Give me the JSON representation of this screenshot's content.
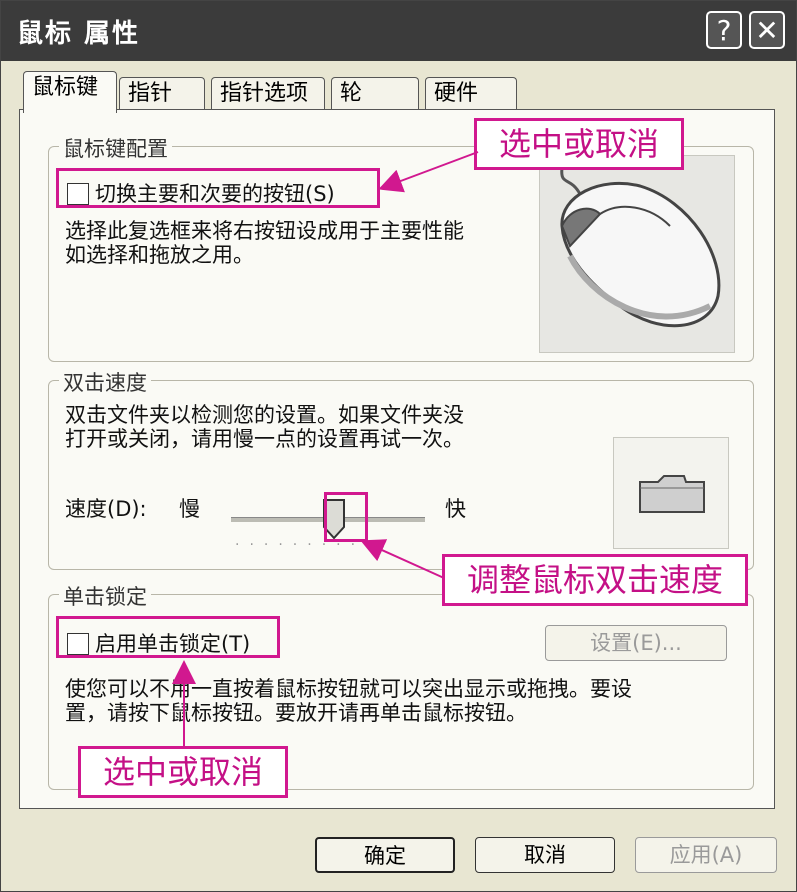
{
  "window": {
    "title": "鼠标  属性",
    "help_glyph": "?",
    "close_glyph": "✕"
  },
  "tabs": [
    {
      "label": "鼠标键",
      "active": true
    },
    {
      "label": "指针",
      "active": false
    },
    {
      "label": "指针选项",
      "active": false
    },
    {
      "label": "轮",
      "active": false
    },
    {
      "label": "硬件",
      "active": false
    }
  ],
  "button_config": {
    "legend": "鼠标键配置",
    "checkbox_label": "切换主要和次要的按钮(S)",
    "checked": false,
    "description": [
      "选择此复选框来将右按钮设成用于主要性能",
      "如选择和拖放之用。"
    ],
    "preview_icon": "mouse-icon"
  },
  "double_click": {
    "legend": "双击速度",
    "description": [
      "双击文件夹以检测您的设置。如果文件夹没",
      "打开或关闭，请用慢一点的设置再试一次。"
    ],
    "speed_label": "速度(D):",
    "slow_label": "慢",
    "fast_label": "快",
    "speed_value_fraction": 0.5,
    "test_icon": "folder-icon"
  },
  "click_lock": {
    "legend": "单击锁定",
    "checkbox_label": "启用单击锁定(T)",
    "checked": false,
    "settings_button": "设置(E)...",
    "description": [
      "使您可以不用一直按着鼠标按钮就可以突出显示或拖拽。要设",
      "置，请按下鼠标按钮。要放开请再单击鼠标按钮。"
    ]
  },
  "callouts": {
    "toggle_buttons": "选中或取消",
    "speed": "调整鼠标双击速度",
    "click_lock": "选中或取消"
  },
  "buttons": {
    "ok": "确定",
    "cancel": "取消",
    "apply": "应用(A)"
  },
  "colors": {
    "callout": "#d1188f",
    "titlebar": "#3b3b3b",
    "window_bg": "#e8e6d2"
  }
}
